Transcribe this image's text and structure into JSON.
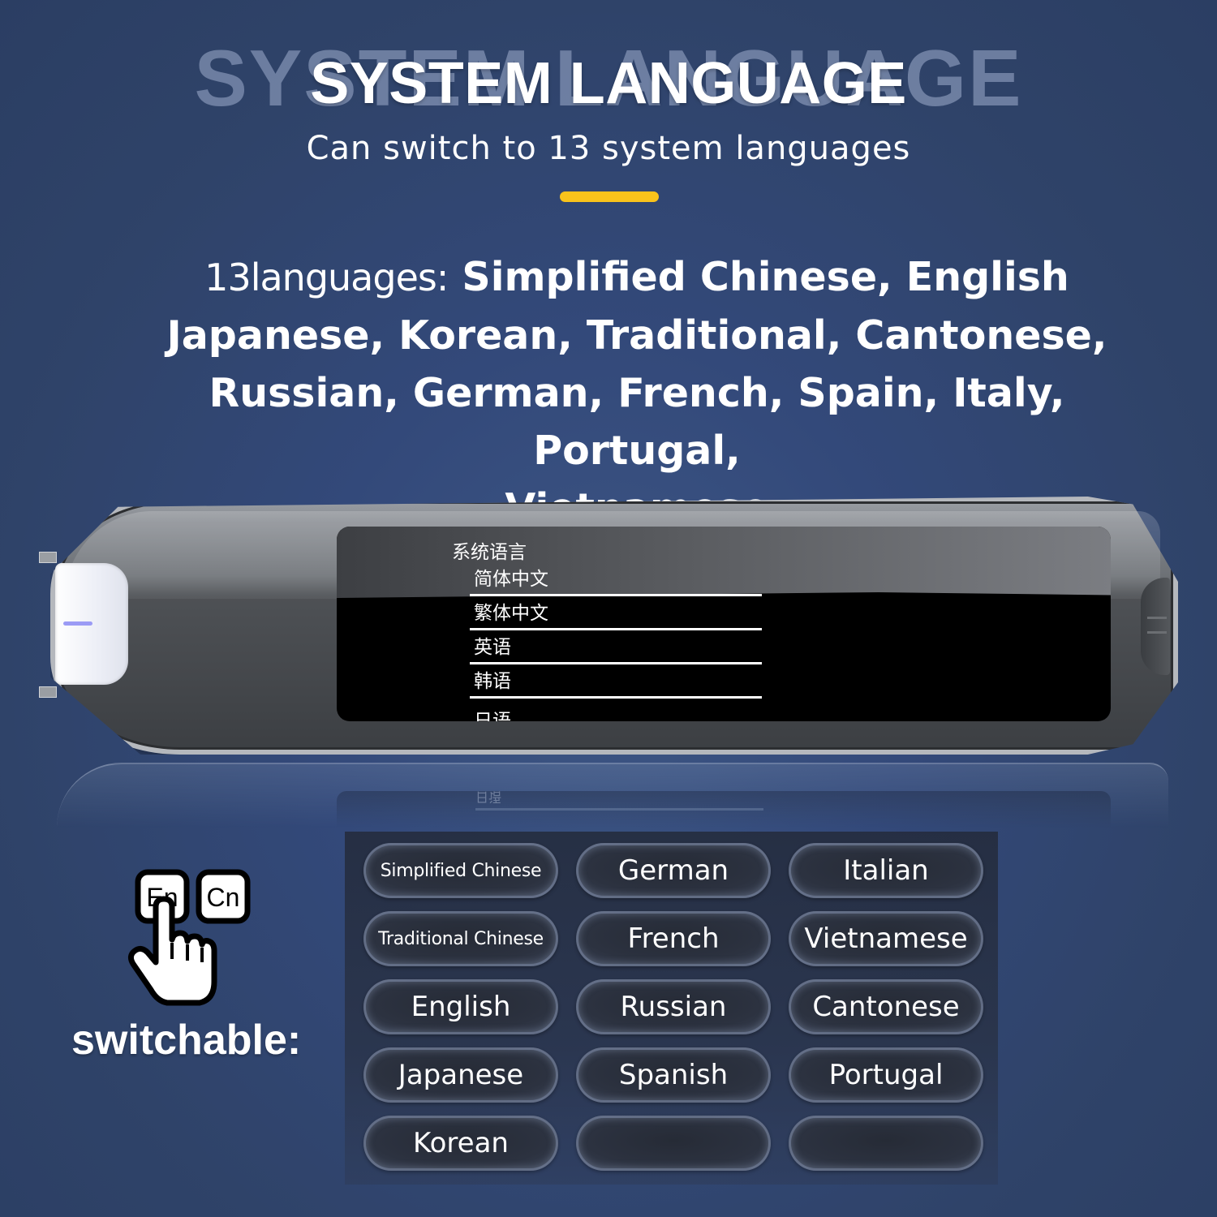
{
  "header": {
    "ghost_title": "SYSTEM LANGUAGE",
    "title": "SYSTEM LANGUAGE",
    "subtitle": "Can switch to 13 system languages",
    "accent_color": "#f9c31b"
  },
  "description": {
    "lead": "13languages:",
    "line1": "Simplified Chinese, English",
    "line2": "Japanese, Korean, Traditional, Cantonese,",
    "line3": "Russian, German, French, Spain, Italy, Portugal,",
    "line4": "Vietnamese"
  },
  "device": {
    "screen_title": "系统语言",
    "menu_items": [
      "简体中文",
      "繁体中文",
      "英语",
      "韩语",
      "日语"
    ],
    "reflection_text": "日语"
  },
  "switch_icon": {
    "key_left": "En",
    "key_right": "Cn",
    "label": "switchable:"
  },
  "language_grid": {
    "column1": [
      "Simplified Chinese",
      "Traditional Chinese",
      "English",
      "Japanese",
      "Korean"
    ],
    "column2": [
      "German",
      "French",
      "Russian",
      "Spanish",
      ""
    ],
    "column3": [
      "Italian",
      "Vietnamese",
      "Cantonese",
      "Portugal",
      ""
    ]
  }
}
